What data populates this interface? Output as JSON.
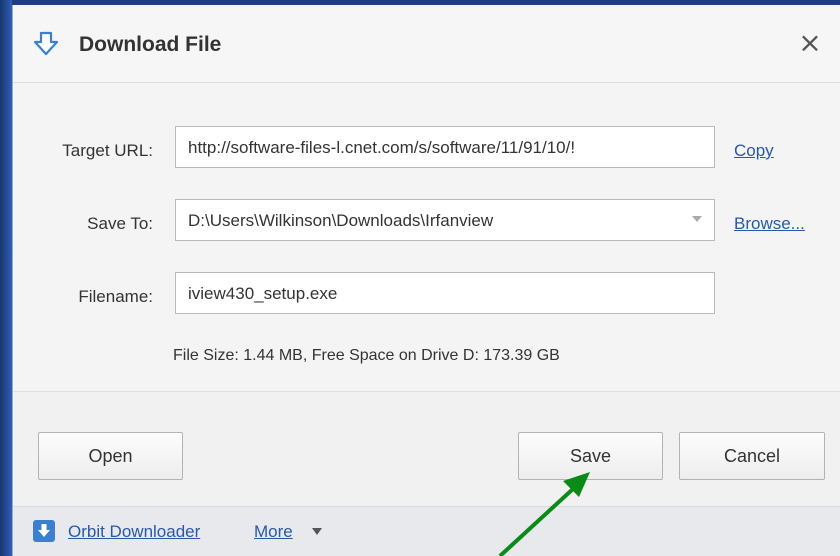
{
  "dialog": {
    "title": "Download File",
    "close_icon": "close-icon",
    "title_icon": "download-arrow-icon"
  },
  "form": {
    "target_url_label": "Target URL:",
    "target_url_value": "http://software-files-l.cnet.com/s/software/11/91/10/!",
    "copy_link": "Copy",
    "save_to_label": "Save To:",
    "save_to_value": "D:\\Users\\Wilkinson\\Downloads\\Irfanview",
    "browse_link": "Browse...",
    "filename_label": "Filename:",
    "filename_value": "iview430_setup.exe",
    "file_info": "File Size: 1.44 MB, Free Space on Drive D: 173.39 GB"
  },
  "buttons": {
    "open": "Open",
    "save": "Save",
    "cancel": "Cancel"
  },
  "footer": {
    "app_link": "Orbit Downloader",
    "more_link": "More",
    "more_icon": "triangle-down-icon"
  },
  "colors": {
    "link": "#2a58a8",
    "icon_blue": "#3c7fd0",
    "annotation_arrow": "#0a8a16"
  }
}
